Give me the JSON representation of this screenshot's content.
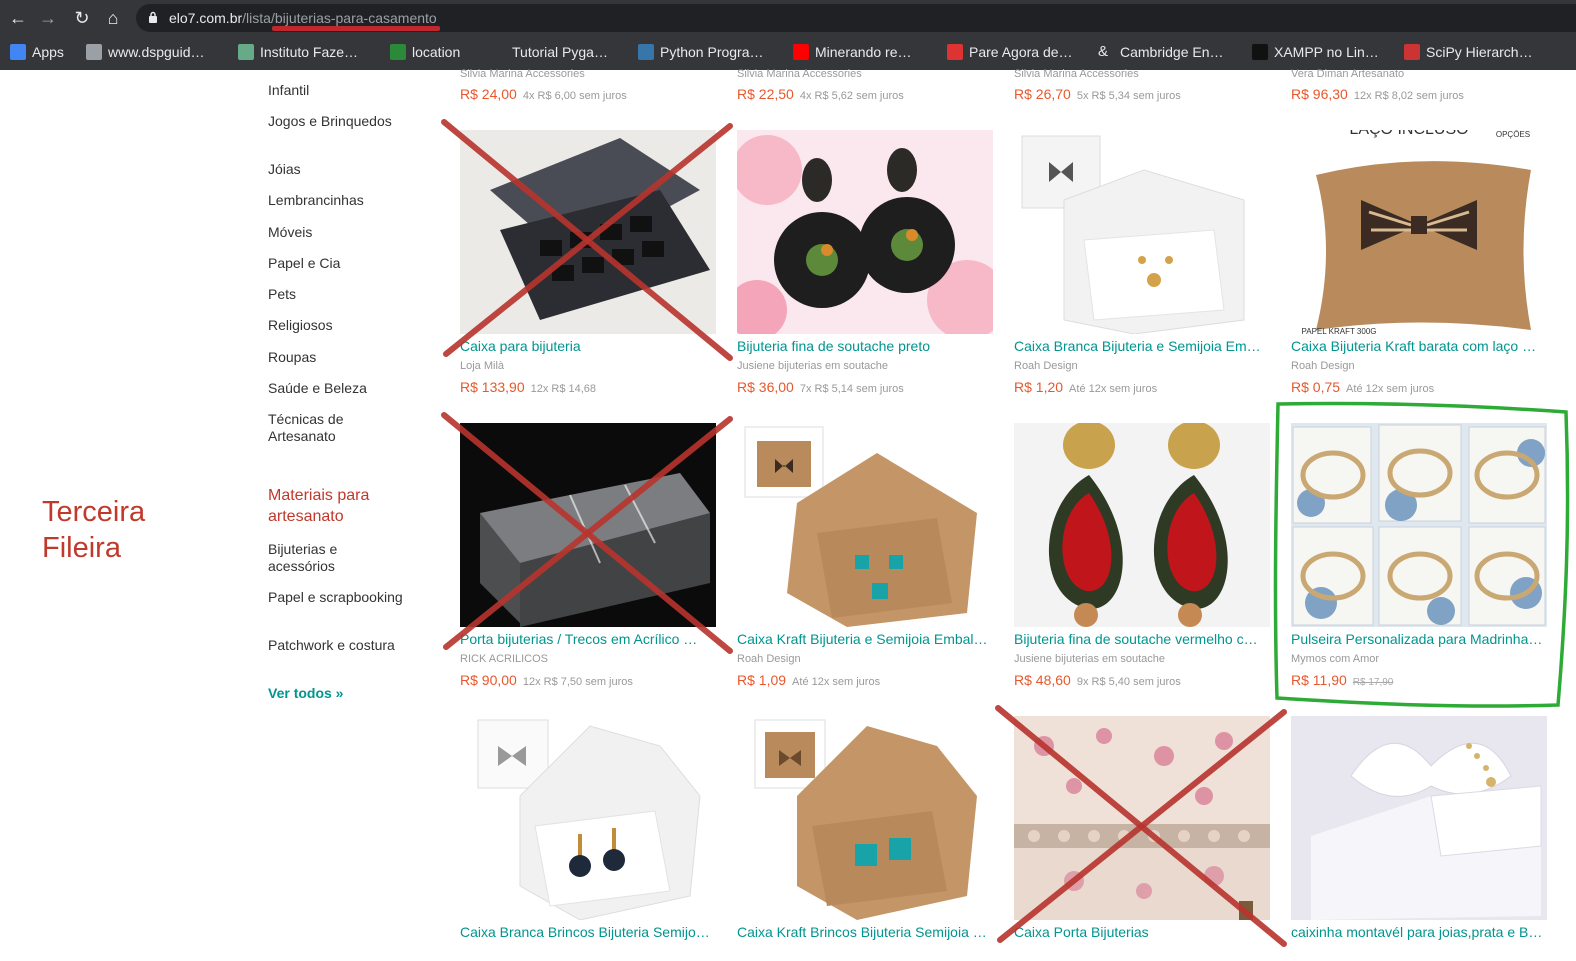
{
  "browser": {
    "url_domain": "elo7.com.br",
    "url_path": "/lista/bijuterias-para-casamento",
    "bookmarks": [
      {
        "label": "Apps",
        "icon": "apps-grid-icon"
      },
      {
        "label": "www.dspguid…",
        "icon": "globe-icon"
      },
      {
        "label": "Instituto Faze…",
        "icon": "site-icon"
      },
      {
        "label": "location",
        "icon": "flag-icon"
      },
      {
        "label": "Tutorial Pyga…",
        "icon": "blank-icon"
      },
      {
        "label": "Python Progra…",
        "icon": "python-icon"
      },
      {
        "label": "Minerando re…",
        "icon": "youtube-icon"
      },
      {
        "label": "Pare Agora de…",
        "icon": "red-site-icon"
      },
      {
        "label": "Cambridge En…",
        "icon": "ampersand-icon"
      },
      {
        "label": "XAMPP no Lin…",
        "icon": "dark-site-icon"
      },
      {
        "label": "SciPy Hierarch…",
        "icon": "scipy-icon"
      }
    ]
  },
  "sidebar": {
    "categories": [
      "Infantil",
      "Jogos e Brinquedos",
      "Jóias",
      "Lembrancinhas",
      "Móveis",
      "Papel e Cia",
      "Pets",
      "Religiosos",
      "Roupas",
      "Saúde e Beleza",
      "Técnicas de Artesanato"
    ],
    "section_title": "Materiais para artesanato",
    "section_items": [
      "Bijuterias e acessórios",
      "Papel e scrapbooking",
      "Patchwork e costura"
    ],
    "see_all": "Ver todos »"
  },
  "annotation": {
    "line1": "Terceira",
    "line2": "Fileira"
  },
  "top_row": [
    {
      "shop": "Silvia Marina Accessories",
      "price": "R$ 24,00",
      "installments": "4x R$ 6,00 sem juros"
    },
    {
      "shop": "Silvia Marina Accessories",
      "price": "R$ 22,50",
      "installments": "4x R$ 5,62 sem juros"
    },
    {
      "shop": "Silvia Marina Accessories",
      "price": "R$ 26,70",
      "installments": "5x R$ 5,34 sem juros"
    },
    {
      "shop": "Vera Diman Artesanato",
      "price": "R$ 96,30",
      "installments": "12x R$ 8,02 sem juros"
    }
  ],
  "row2": [
    {
      "title": "Caixa para bijuteria",
      "shop": "Loja Milà",
      "price": "R$ 133,90",
      "installments": "12x R$ 14,68",
      "image": "jewelry-box-black",
      "crossed": true
    },
    {
      "title": "Bijuteria fina de soutache preto",
      "shop": "Jusiene bijuterias em soutache",
      "price": "R$ 36,00",
      "installments": "7x R$ 5,14 sem juros",
      "image": "earrings-black-soutache",
      "crossed": false
    },
    {
      "title": "Caixa Branca Bijuteria e Semijoia Em…",
      "shop": "Roah Design",
      "price": "R$ 1,20",
      "installments": "Até 12x sem juros",
      "image": "white-box",
      "crossed": false
    },
    {
      "title": "Caixa Bijuteria Kraft barata com laço …",
      "shop": "Roah Design",
      "price": "R$ 0,75",
      "installments": "Até 12x sem juros",
      "image": "kraft-pillow-box",
      "crossed": false,
      "image_text_top": "LAÇO INCLUSO",
      "image_text_right": "OPÇÕES",
      "image_text_bottom": "PAPEL KRAFT 300G"
    }
  ],
  "row3": [
    {
      "title": "Porta bijuterias / Trecos em Acrílico …",
      "shop": "RICK ACRILICOS",
      "price": "R$ 90,00",
      "installments": "12x R$ 7,50 sem juros",
      "image": "acrylic-box",
      "crossed": true
    },
    {
      "title": "Caixa Kraft Bijuteria e Semijoia Embal…",
      "shop": "Roah Design",
      "price": "R$ 1,09",
      "installments": "Até 12x sem juros",
      "image": "kraft-box-necklace",
      "crossed": false
    },
    {
      "title": "Bijuteria fina de soutache vermelho c…",
      "shop": "Jusiene bijuterias em soutache",
      "price": "R$ 48,60",
      "installments": "9x R$ 5,40 sem juros",
      "image": "earrings-red-soutache",
      "crossed": false
    },
    {
      "title": "Pulseira Personalizada para Madrinha…",
      "shop": "Mymos com Amor",
      "price": "R$ 11,90",
      "old_price": "R$ 17,90",
      "image": "pearl-bracelets",
      "crossed": false,
      "highlighted": true
    }
  ],
  "row4": [
    {
      "title": "Caixa Branca Brincos Bijuteria Semijo…",
      "image": "white-box-earrings",
      "crossed": false
    },
    {
      "title": "Caixa Kraft Brincos Bijuteria Semijoia …",
      "image": "kraft-box-earrings",
      "crossed": false
    },
    {
      "title": "Caixa Porta Bijuterias",
      "image": "floral-box",
      "crossed": true
    },
    {
      "title": "caixinha montavél para joias,prata e B…",
      "image": "white-bow-box",
      "crossed": false
    }
  ],
  "colors": {
    "teal": "#00958f",
    "price": "#e8582c",
    "annot_red": "#c0392b",
    "cross_red": "#b8342e",
    "highlight_green": "#2eaa36"
  }
}
